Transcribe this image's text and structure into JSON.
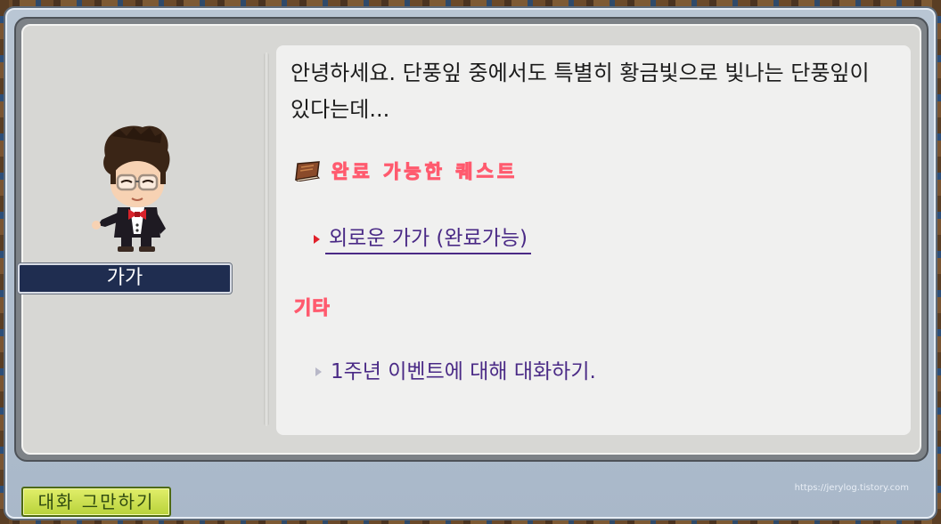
{
  "npc": {
    "name": "가가",
    "message": "안녕하세요. 단풍잎 중에서도 특별히 황금빛으로 빛나는 단풍잎이 있다는데..."
  },
  "quests": {
    "completable_header": "완료 가능한 퀘스트",
    "completable_items": [
      {
        "label": "외로운 가가 (완료가능)"
      }
    ],
    "other_header": "기타",
    "other_items": [
      {
        "label": "1주년 이벤트에 대해 대화하기."
      }
    ]
  },
  "footer": {
    "end_chat_label": "대화 그만하기",
    "watermark": "https://jerylog.tistory.com"
  },
  "colors": {
    "quest_header": "#ff2a46",
    "quest_link": "#4a2a86",
    "nameplate_bg": "#1f2d50",
    "end_button": "#c9dd4c"
  },
  "icons": {
    "quest_book": "quest-book-icon"
  }
}
